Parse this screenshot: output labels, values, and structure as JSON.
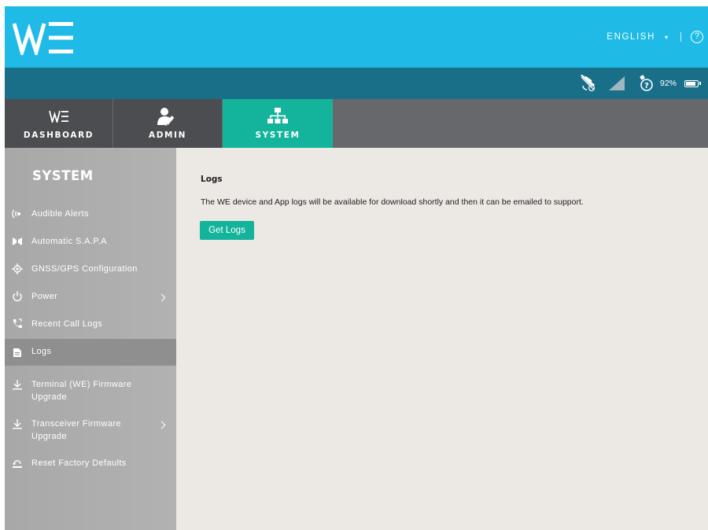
{
  "header": {
    "logo_text": "WE",
    "language": "ENGLISH",
    "language_caret": "▾",
    "help_symbol": "?"
  },
  "statusbar": {
    "icons": [
      "gps-off-icon",
      "signal-strength-icon",
      "satellite-status-icon",
      "battery-icon"
    ],
    "battery_percent": "92%",
    "battery_level": 0.92
  },
  "tabs": [
    {
      "label": "DASHBOARD",
      "icon": "we-logo-icon",
      "active": false
    },
    {
      "label": "ADMIN",
      "icon": "admin-user-icon",
      "active": false
    },
    {
      "label": "SYSTEM",
      "icon": "sitemap-icon",
      "active": true
    }
  ],
  "sidebar": {
    "title": "SYSTEM",
    "items": [
      {
        "label": "Audible Alerts",
        "icon": "audible-alerts-icon"
      },
      {
        "label": "Automatic S.A.P.A",
        "icon": "sapa-icon"
      },
      {
        "label": "GNSS/GPS Configuration",
        "icon": "gps-target-icon"
      },
      {
        "label": "Power",
        "icon": "power-icon",
        "has_submenu": true
      },
      {
        "label": "Recent Call Logs",
        "icon": "phone-icon"
      },
      {
        "label": "Logs",
        "icon": "logs-icon",
        "active": true
      },
      {
        "label_line1": "Terminal (WE) Firmware",
        "label_line2": "Upgrade",
        "icon": "download-icon"
      },
      {
        "label_line1": "Transceiver Firmware",
        "label_line2": "Upgrade",
        "icon": "download-icon",
        "has_submenu": true
      },
      {
        "label": "Reset Factory Defaults",
        "icon": "reset-icon"
      }
    ]
  },
  "main": {
    "title": "Logs",
    "description": "The WE device and App logs will be available for download shortly and then it can be emailed to support.",
    "button_label": "Get Logs"
  },
  "colors": {
    "header": "#1fbbe6",
    "statusbar": "#1a6f88",
    "tab_inactive": "#4c4d50",
    "tab_active": "#14b39b",
    "tab_bar": "#67686b",
    "sidebar": "#a8a8a8",
    "sidebar_active": "#8f8f8f",
    "content_bg": "#ece8e3",
    "accent": "#14b39b"
  }
}
